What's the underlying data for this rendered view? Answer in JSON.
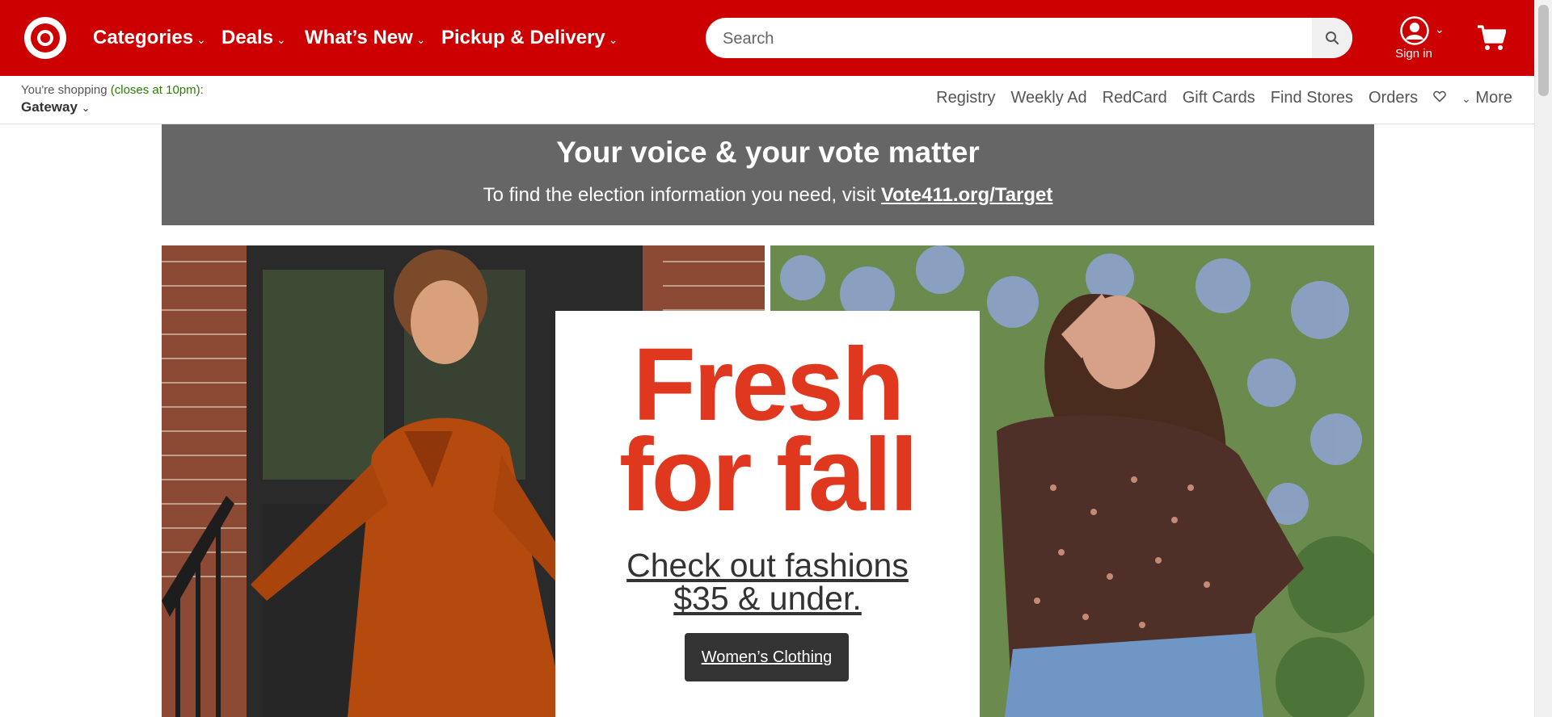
{
  "brand": {
    "name": "Target",
    "color": "#cc0000"
  },
  "nav": [
    {
      "label": "Categories"
    },
    {
      "label": "Deals"
    },
    {
      "label": "What’s New"
    },
    {
      "label": "Pickup & Delivery"
    }
  ],
  "search": {
    "placeholder": "Search",
    "icon": "search-icon"
  },
  "account": {
    "label": "Sign in",
    "icon": "user-icon"
  },
  "cart": {
    "icon": "cart-icon"
  },
  "store": {
    "prefix": "You're shopping",
    "hours": "(closes at 10pm):",
    "name": "Gateway"
  },
  "utility_links": [
    "Registry",
    "Weekly Ad",
    "RedCard",
    "Gift Cards",
    "Find Stores",
    "Orders"
  ],
  "favorites": {
    "icon": "heart-icon"
  },
  "more": {
    "label": "More"
  },
  "banner": {
    "title": "Your voice & your vote matter",
    "text": "To find the election information you need, visit",
    "link": "Vote411.org/Target",
    "bg": "#666666"
  },
  "hero": {
    "headline_line1": "Fresh",
    "headline_line2": "for fall",
    "sub_line1": "Check out fashions",
    "sub_line2": "$35 & under.",
    "button": "Women’s Clothing",
    "headline_color": "#e0381f"
  }
}
